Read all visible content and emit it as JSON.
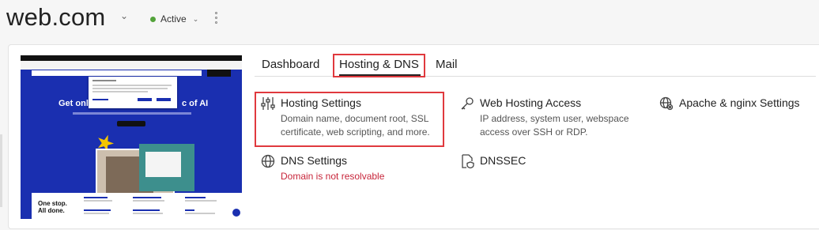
{
  "header": {
    "domain": "web.com",
    "status": "Active"
  },
  "preview": {
    "heading_left": "Get onl",
    "heading_right": "c of AI",
    "bottom_text_1": "One stop.",
    "bottom_text_2": "All done."
  },
  "tabs": [
    {
      "label": "Dashboard"
    },
    {
      "label": "Hosting & DNS",
      "active": true
    },
    {
      "label": "Mail"
    }
  ],
  "tools": [
    {
      "title": "Hosting Settings",
      "desc": "Domain name, document root, SSL certificate, web scripting, and more.",
      "icon": "sliders-icon"
    },
    {
      "title": "Web Hosting Access",
      "desc": "IP address, system user, webspace access over SSH or RDP.",
      "icon": "key-icon"
    },
    {
      "title": "Apache & nginx Settings",
      "desc": "",
      "icon": "globe-gear-icon"
    },
    {
      "title": "DNS Settings",
      "desc": "Domain is not resolvable",
      "icon": "globe-icon"
    },
    {
      "title": "DNSSEC",
      "desc": "",
      "icon": "shield-file-icon"
    }
  ],
  "colors": {
    "status_green": "#53a33a",
    "highlight_red": "#e0393e",
    "warning_red": "#c7253a",
    "preview_blue": "#1a2fb0"
  }
}
